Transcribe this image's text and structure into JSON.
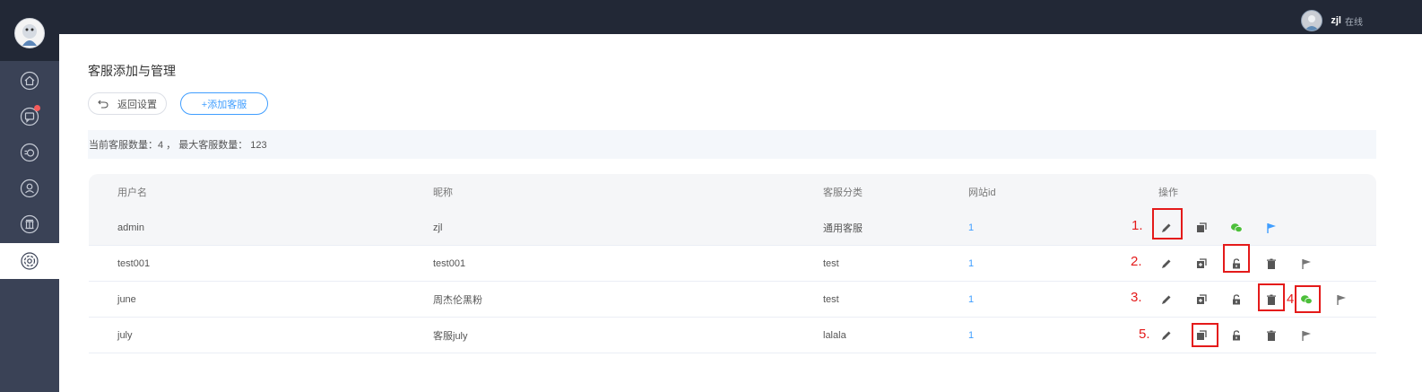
{
  "topbar": {
    "user_name": "zjl",
    "user_status": "在线"
  },
  "sidebar": {
    "items": [
      {
        "icon": "home-icon"
      },
      {
        "icon": "chat-icon",
        "has_badge": true
      },
      {
        "icon": "history-icon"
      },
      {
        "icon": "user-icon"
      },
      {
        "icon": "building-icon"
      },
      {
        "icon": "settings-icon",
        "active": true
      }
    ]
  },
  "page": {
    "title": "客服添加与管理",
    "back_label": "返回设置",
    "add_label": "+添加客服",
    "info_text": "当前客服数量：4 ， 最大客服数量： 123"
  },
  "table": {
    "headers": {
      "username": "用户名",
      "nickname": "昵称",
      "category": "客服分类",
      "site_id": "网站id",
      "actions": "操作"
    },
    "rows": [
      {
        "username": "admin",
        "nickname": "zjl",
        "category": "通用客服",
        "site_id": "1"
      },
      {
        "username": "test001",
        "nickname": "test001",
        "category": "test",
        "site_id": "1"
      },
      {
        "username": "june",
        "nickname": "周杰伦黑粉",
        "category": "test",
        "site_id": "1"
      },
      {
        "username": "july",
        "nickname": "客服july",
        "category": "lalala",
        "site_id": "1"
      }
    ]
  },
  "annotations": [
    "1.",
    "2.",
    "3.",
    "4",
    "5."
  ],
  "colors": {
    "accent": "#409eff",
    "wechat": "#4cbf3a",
    "annotation_red": "#e41a1a",
    "sidebar": "#3a4256",
    "topbar": "#222836"
  }
}
